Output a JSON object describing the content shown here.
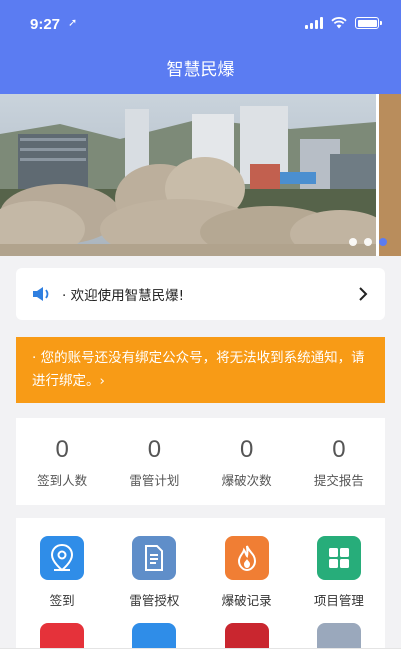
{
  "status_bar": {
    "time": "9:27",
    "location_glyph": "➚"
  },
  "nav": {
    "title": "智慧民爆"
  },
  "banner": {
    "slides": 3,
    "active_index": 2
  },
  "notice": {
    "text": "·  欢迎使用智慧民爆!"
  },
  "warning": {
    "text": "· 您的账号还没有绑定公众号，将无法收到系统通知，请进行绑定。›"
  },
  "stats": [
    {
      "value": "0",
      "label": "签到人数"
    },
    {
      "value": "0",
      "label": "雷管计划"
    },
    {
      "value": "0",
      "label": "爆破次数"
    },
    {
      "value": "0",
      "label": "提交报告"
    }
  ],
  "apps": [
    {
      "label": "签到",
      "icon": "location-pin-icon",
      "color": "#2f8de8"
    },
    {
      "label": "雷管授权",
      "icon": "document-icon",
      "color": "#5f8ec9"
    },
    {
      "label": "爆破记录",
      "icon": "flame-icon",
      "color": "#f07e34"
    },
    {
      "label": "项目管理",
      "icon": "grid-icon",
      "color": "#27ad7a"
    }
  ],
  "apps_row2": [
    {
      "icon": "red-app-icon",
      "color": "#e5323a"
    },
    {
      "icon": "shield-icon",
      "color": "#2f8de8"
    },
    {
      "icon": "circle-app-icon",
      "color": "#c9262f"
    },
    {
      "icon": "shapes-icon",
      "color": "#9aa8bc"
    }
  ]
}
